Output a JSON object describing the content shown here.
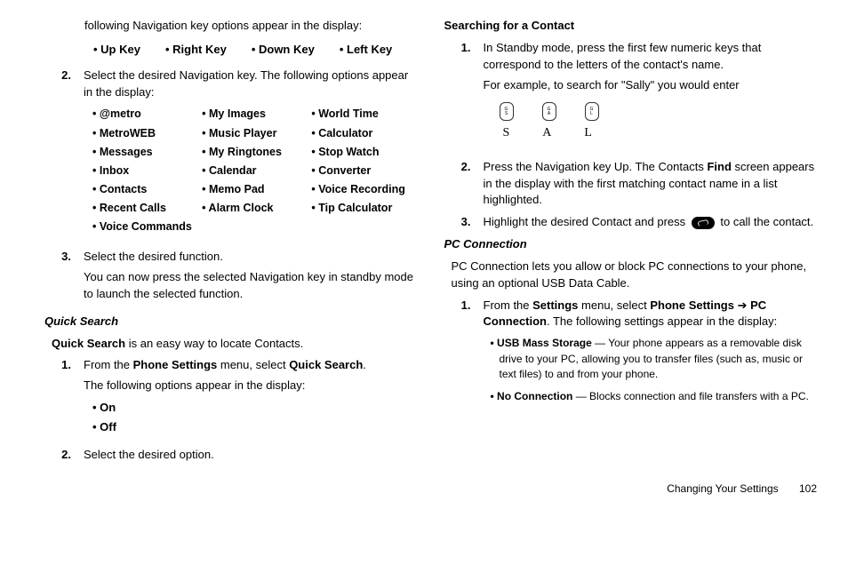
{
  "col1": {
    "intro": "following Navigation key options appear in the display:",
    "keys": [
      "Up Key",
      "Right Key",
      "Down Key",
      "Left Key"
    ],
    "step2": {
      "num": "2.",
      "text": "Select the desired Navigation key. The following options appear in the display:",
      "options": [
        "@metro",
        "My Images",
        "World Time",
        "MetroWEB",
        " Music Player",
        "Calculator",
        "Messages",
        "My Ringtones",
        "Stop Watch",
        "Inbox",
        "Calendar",
        "Converter",
        "Contacts",
        "Memo Pad",
        "Voice Recording",
        "Recent Calls",
        "Alarm Clock",
        "Tip Calculator",
        "Voice Commands",
        "",
        ""
      ]
    },
    "step3": {
      "num": "3.",
      "text1": "Select the desired function.",
      "text2": "You can now press the selected Navigation key in standby mode to launch the selected function."
    },
    "qs_head": "Quick Search",
    "qs_intro_pre": "Quick Search",
    "qs_intro_post": " is an easy way to locate Contacts.",
    "qs1": {
      "num": "1.",
      "pre": "From the ",
      "b1": "Phone Settings",
      "mid": " menu, select ",
      "b2": "Quick Search",
      "post": ".",
      "followup": "The following options appear in the display:",
      "opts": [
        "On",
        "Off"
      ]
    },
    "qs2": {
      "num": "2.",
      "text": "Select the desired option."
    }
  },
  "col2": {
    "search_head": "Searching for a Contact",
    "s1": {
      "num": "1.",
      "text": "In Standby mode, press the first few numeric keys that correspond to the letters of the contact's name.",
      "example": "For example, to search for \"Sally\" you would enter",
      "icons": [
        "G\nS",
        "G\nA",
        "G\nL"
      ],
      "letters": [
        "S",
        "A",
        "L"
      ]
    },
    "s2": {
      "num": "2.",
      "pre": "Press the Navigation key Up. The Contacts ",
      "b": "Find",
      "post": " screen appears in the display with the first matching contact name in a list highlighted."
    },
    "s3": {
      "num": "3.",
      "pre": "Highlight the desired Contact and press ",
      "post": " to call the contact."
    },
    "pc_head": "PC Connection",
    "pc_intro": "PC Connection lets you allow or block PC connections to your phone, using an optional USB Data Cable.",
    "pc1": {
      "num": "1.",
      "pre": "From the ",
      "b1": "Settings",
      "mid1": " menu, select ",
      "b2": "Phone Settings",
      "arrow": " ➔ ",
      "b3": "PC Connection",
      "post": ". The following settings appear in the display:",
      "u1b": "USB Mass Storage",
      "u1t": " — Your phone appears as a removable disk drive to your PC, allowing you to transfer files (such as, music or text files) to and from your phone.",
      "u2b": "No Connection",
      "u2t": " — Blocks connection and file transfers with a PC."
    }
  },
  "footer": {
    "section": "Changing Your Settings",
    "page": "102"
  }
}
